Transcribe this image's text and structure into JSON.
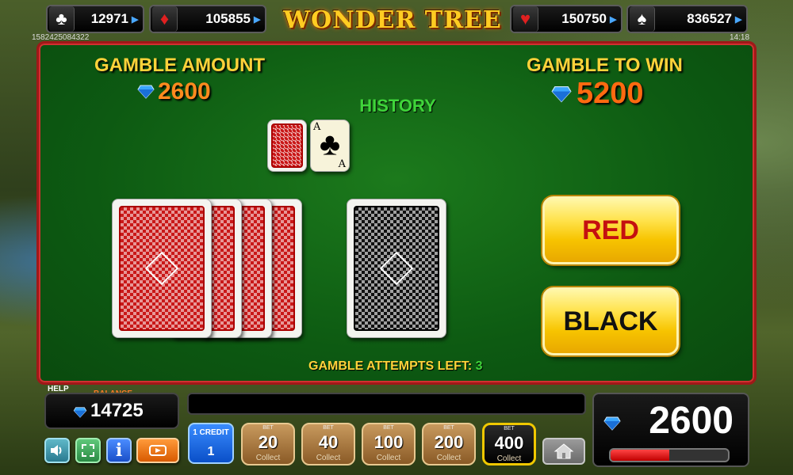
{
  "jackpots": [
    {
      "suit": "clubs",
      "glyph": "♣",
      "amount": "12971"
    },
    {
      "suit": "diamonds",
      "glyph": "♦",
      "amount": "105855"
    },
    {
      "suit": "hearts",
      "glyph": "♥",
      "amount": "150750"
    },
    {
      "suit": "spades",
      "glyph": "♠",
      "amount": "836527"
    }
  ],
  "logo": "WONDER TREE",
  "tiny": {
    "left_id": "1582425084322",
    "right_time": "14:18",
    "help": "HELP"
  },
  "gamble": {
    "amount_label": "GAMBLE AMOUNT",
    "amount_value": "2600",
    "to_win_label": "GAMBLE TO WIN",
    "to_win_value": "5200",
    "history_label": "HISTORY",
    "history_card": {
      "rank": "A",
      "suit": "♣"
    },
    "red_label": "RED",
    "black_label": "BLACK",
    "attempts_label": "GAMBLE ATTEMPTS LEFT:",
    "attempts_value": "3"
  },
  "bottom": {
    "balance_label": "BALANCE",
    "balance_value": "14725",
    "win_value": "2600",
    "win_progress": 0.5,
    "credit_line1": "1 CREDIT",
    "credit_line2": "1",
    "bet_tag": "BET",
    "collect": "Collect",
    "bets": [
      "20",
      "40",
      "100",
      "200",
      "400"
    ],
    "active_bet": "400"
  },
  "colors": {
    "panel_green": "#0d5a12",
    "gold": "#ffd23a",
    "orange": "#ff8a1e",
    "history_green": "#3fd43a",
    "red_button_text": "#c41010"
  },
  "icons": [
    "sound-icon",
    "fullscreen-icon",
    "info-icon",
    "autoplay-icon",
    "home-icon",
    "diamond-icon"
  ]
}
